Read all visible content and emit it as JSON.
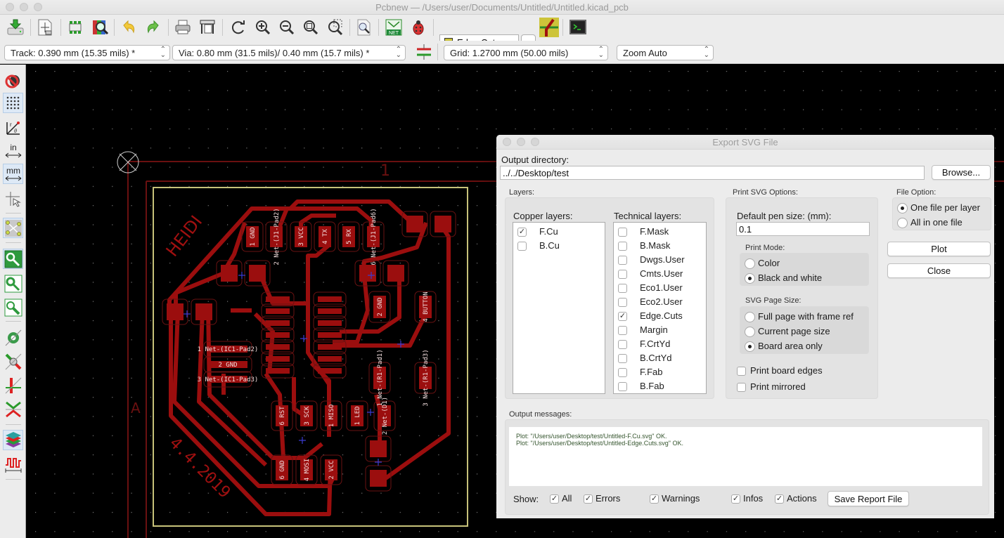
{
  "window": {
    "title": "Pcbnew — /Users/user/Documents/Untitled/Untitled.kicad_pcb"
  },
  "toolbar_top": {
    "icons": [
      "save-board-icon",
      "page-settings-icon",
      "footprint-editor-icon",
      "footprint-library-browser-icon",
      "undo-icon",
      "redo-icon",
      "print-icon",
      "plot-icon",
      "redraw-icon",
      "zoom-in-icon",
      "zoom-out-icon",
      "zoom-fit-icon",
      "zoom-selection-icon",
      "find-icon",
      "netlist-icon",
      "drc-bug-icon",
      "route-mode-icon",
      "python-console-icon"
    ],
    "active_layer": "Edge.Cuts",
    "active_layer_color": "#cdc43a",
    "netlist_badge": "NET"
  },
  "toolbar_aux": {
    "track": "Track: 0.390 mm (15.35 mils) *",
    "via": "Via: 0.80 mm (31.5 mils)/ 0.40 mm (15.7 mils) *",
    "grid": "Grid: 1.2700 mm (50.00 mils)",
    "zoom": "Zoom Auto"
  },
  "left_toolbar": {
    "items": [
      {
        "name": "drc-off-icon",
        "active": false
      },
      {
        "name": "grid-toggle-icon",
        "active": true
      },
      {
        "name": "polar-coords-icon",
        "active": false,
        "label": "r θ"
      },
      {
        "name": "units-inches-icon",
        "active": false,
        "label": "in"
      },
      {
        "name": "units-mm-icon",
        "active": true,
        "label": "mm"
      },
      {
        "name": "full-crosshair-icon",
        "active": false
      },
      {
        "name": "ratsnest-icon",
        "active": true
      },
      {
        "name": "pad-fill-icon",
        "active": true
      },
      {
        "name": "via-fill-icon",
        "active": false
      },
      {
        "name": "track-fill-icon",
        "active": false
      },
      {
        "name": "zone-display-icon",
        "active": false
      },
      {
        "name": "zone-outline-icon",
        "active": false
      },
      {
        "name": "high-contrast-icon",
        "active": false
      },
      {
        "name": "track-cleanup-icon",
        "active": false
      },
      {
        "name": "layers-manager-icon",
        "active": true
      },
      {
        "name": "microwave-tools-icon",
        "active": false
      }
    ]
  },
  "canvas": {
    "background": "#000000",
    "copper_color": "#9b0e0e",
    "edge_color": "#c7c27a",
    "frame_labels": {
      "top": "1",
      "left": "A"
    },
    "silk_texts": [
      "HEIDI",
      "4.4.2019"
    ],
    "pad_labels": [
      {
        "num": "1",
        "net": "GND"
      },
      {
        "num": "2",
        "net": "Net-(J1-Pad2)"
      },
      {
        "num": "3",
        "net": "VCC"
      },
      {
        "num": "4",
        "net": "TX"
      },
      {
        "num": "5",
        "net": "RX"
      },
      {
        "num": "6",
        "net": "Net-(J1-Pad6)"
      },
      {
        "num": "2",
        "net": "GND"
      },
      {
        "num": "4",
        "net": "BUTTON"
      },
      {
        "num": "1",
        "net": "Net-(R1-Pad1)"
      },
      {
        "num": "3",
        "net": "Net-(R1-Pad3)"
      },
      {
        "num": "1",
        "net": "Net-(IC1-Pad2)"
      },
      {
        "num": "2",
        "net": "GND"
      },
      {
        "num": "3",
        "net": "Net-(IC1-Pad3)"
      },
      {
        "num": "6",
        "net": "RST"
      },
      {
        "num": "3",
        "net": "SCK"
      },
      {
        "num": "1",
        "net": "MISO"
      },
      {
        "num": "1",
        "net": "LED"
      },
      {
        "num": "2",
        "net": "Net-(D1)"
      },
      {
        "num": "6",
        "net": "GND"
      },
      {
        "num": "4",
        "net": "MOSI"
      },
      {
        "num": "2",
        "net": "VCC"
      }
    ]
  },
  "dialog": {
    "title": "Export SVG File",
    "output_directory_label": "Output directory:",
    "output_directory_value": "../../Desktop/test",
    "browse_label": "Browse...",
    "layers_label": "Layers:",
    "copper_label": "Copper layers:",
    "copper_layers": [
      {
        "name": "F.Cu",
        "checked": true
      },
      {
        "name": "B.Cu",
        "checked": false
      }
    ],
    "technical_label": "Technical layers:",
    "technical_layers": [
      {
        "name": "F.Mask",
        "checked": false
      },
      {
        "name": "B.Mask",
        "checked": false
      },
      {
        "name": "Dwgs.User",
        "checked": false
      },
      {
        "name": "Cmts.User",
        "checked": false
      },
      {
        "name": "Eco1.User",
        "checked": false
      },
      {
        "name": "Eco2.User",
        "checked": false
      },
      {
        "name": "Edge.Cuts",
        "checked": true
      },
      {
        "name": "Margin",
        "checked": false
      },
      {
        "name": "F.CrtYd",
        "checked": false
      },
      {
        "name": "B.CrtYd",
        "checked": false
      },
      {
        "name": "F.Fab",
        "checked": false
      },
      {
        "name": "B.Fab",
        "checked": false
      }
    ],
    "svg_options_label": "Print SVG Options:",
    "pen_size_label": "Default pen size: (mm):",
    "pen_size_value": "0.1",
    "print_mode_label": "Print Mode:",
    "print_modes": [
      {
        "label": "Color",
        "selected": false
      },
      {
        "label": "Black and white",
        "selected": true
      }
    ],
    "page_size_label": "SVG Page Size:",
    "page_sizes": [
      {
        "label": "Full page with  frame ref",
        "selected": false
      },
      {
        "label": "Current page size",
        "selected": false
      },
      {
        "label": "Board area only",
        "selected": true
      }
    ],
    "print_board_edges_label": "Print board edges",
    "print_board_edges_checked": false,
    "print_mirrored_label": "Print mirrored",
    "print_mirrored_checked": false,
    "file_option_label": "File Option:",
    "file_options": [
      {
        "label": "One file per layer",
        "selected": true
      },
      {
        "label": "All in one file",
        "selected": false
      }
    ],
    "plot_label": "Plot",
    "close_label": "Close",
    "output_messages_label": "Output messages:",
    "messages": [
      "Plot: \"/Users/user/Desktop/test/Untitled-F.Cu.svg\" OK.",
      "Plot: \"/Users/user/Desktop/test/Untitled-Edge.Cuts.svg\" OK."
    ],
    "show_label": "Show:",
    "show_filters": [
      {
        "label": "All",
        "checked": true
      },
      {
        "label": "Errors",
        "checked": true
      },
      {
        "label": "Warnings",
        "checked": true
      },
      {
        "label": "Infos",
        "checked": true
      },
      {
        "label": "Actions",
        "checked": true
      }
    ],
    "save_report_label": "Save Report File"
  }
}
